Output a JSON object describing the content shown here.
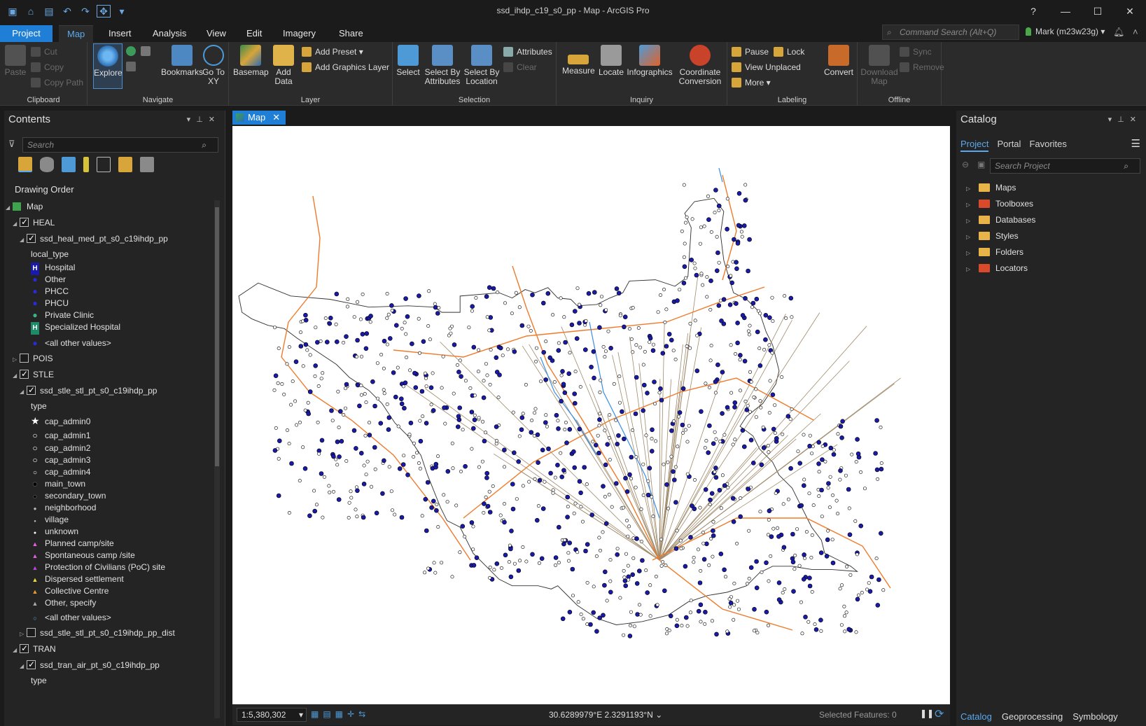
{
  "window": {
    "title": "ssd_ihdp_c19_s0_pp - Map - ArcGIS Pro",
    "help": "?",
    "minimize": "—",
    "maximize": "☐",
    "close": "✕"
  },
  "ribbon_tabs": [
    "Project",
    "Map",
    "Insert",
    "Analysis",
    "View",
    "Edit",
    "Imagery",
    "Share"
  ],
  "command_search": {
    "placeholder": "Command Search (Alt+Q)"
  },
  "user": {
    "name": "Mark (m23w23g)"
  },
  "ribbon": {
    "clipboard": {
      "label": "Clipboard",
      "paste": "Paste",
      "cut": "Cut",
      "copy": "Copy",
      "copy_path": "Copy Path"
    },
    "navigate": {
      "label": "Navigate",
      "explore": "Explore",
      "bookmarks": "Bookmarks",
      "go_to_xy": "Go To XY"
    },
    "layer": {
      "label": "Layer",
      "basemap": "Basemap",
      "add_data": "Add Data",
      "add_preset": "Add Preset",
      "add_graphics_layer": "Add Graphics Layer"
    },
    "selection": {
      "label": "Selection",
      "select": "Select",
      "select_by_attributes": "Select By Attributes",
      "select_by_location": "Select By Location",
      "attributes": "Attributes",
      "clear": "Clear"
    },
    "inquiry": {
      "label": "Inquiry",
      "measure": "Measure",
      "locate": "Locate",
      "infographics": "Infographics",
      "coordinate_conversion": "Coordinate Conversion"
    },
    "labeling": {
      "label": "Labeling",
      "pause": "Pause",
      "lock": "Lock",
      "view_unplaced": "View Unplaced",
      "more": "More",
      "convert": "Convert"
    },
    "offline": {
      "label": "Offline",
      "download_map": "Download Map",
      "sync": "Sync",
      "remove": "Remove"
    }
  },
  "contents": {
    "title": "Contents",
    "search_placeholder": "Search",
    "drawing_order": "Drawing Order",
    "map": "Map",
    "heal": "HEAL",
    "heal_layer": "ssd_heal_med_pt_s0_c19ihdp_pp",
    "heal_field": "local_type",
    "heal_classes": [
      "Hospital",
      "Other",
      "PHCC",
      "PHCU",
      "Private Clinic",
      "Specialized Hospital",
      "<all other values>"
    ],
    "pois": "POIS",
    "stle": "STLE",
    "stle_layer": "ssd_stle_stl_pt_s0_c19ihdp_pp",
    "stle_field": "type",
    "stle_classes": [
      "cap_admin0",
      "cap_admin1",
      "cap_admin2",
      "cap_admin3",
      "cap_admin4",
      "main_town",
      "secondary_town",
      "neighborhood",
      "village",
      "unknown",
      "Planned camp/site",
      "Spontaneous camp /site",
      "Protection of Civilians (PoC) site",
      "Dispersed settlement",
      "Collective Centre",
      "Other, specify",
      "<all other values>"
    ],
    "stle_dist": "ssd_stle_stl_pt_s0_c19ihdp_pp_dist",
    "tran": "TRAN",
    "tran_layer": "ssd_tran_air_pt_s0_c19ihdp_pp",
    "tran_field": "type"
  },
  "map_view": {
    "tab": "Map",
    "scale": "1:5,380,302",
    "coordinates": "30.6289979°E 2.3291193°N",
    "selected_features": "Selected Features: 0"
  },
  "catalog": {
    "title": "Catalog",
    "tabs": [
      "Project",
      "Portal",
      "Favorites"
    ],
    "search_placeholder": "Search Project",
    "items": [
      "Maps",
      "Toolboxes",
      "Databases",
      "Styles",
      "Folders",
      "Locators"
    ],
    "bottom_tabs": [
      "Catalog",
      "Geoprocessing",
      "Symbology"
    ]
  },
  "colors": {
    "accent": "#1f7ed6",
    "health_points": "#1a1aa8",
    "roads": "#f07a2a",
    "rivers": "#3a8ee6",
    "links": "#a08a6a"
  }
}
